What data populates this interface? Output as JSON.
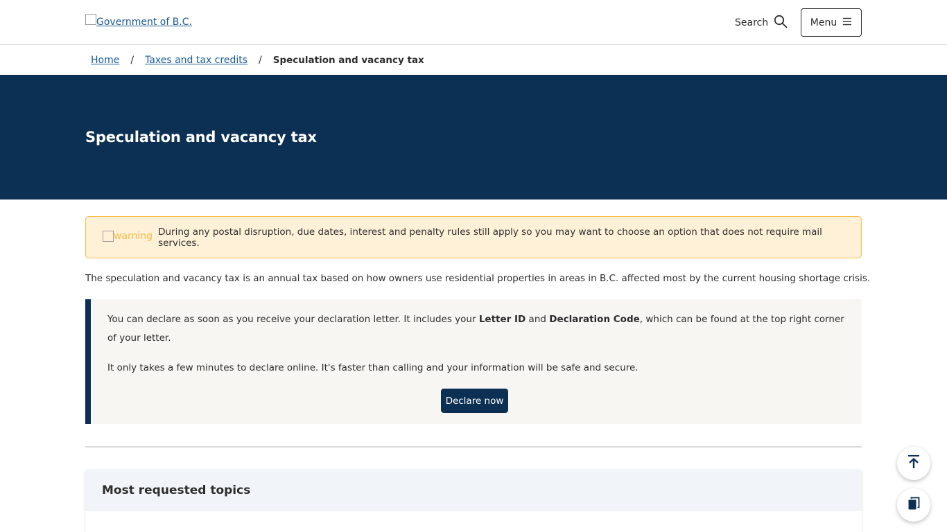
{
  "header": {
    "logo_alt": "Government of B.C.",
    "search_label": "Search",
    "menu_label": "Menu"
  },
  "breadcrumb": {
    "home": "Home",
    "separator": "/",
    "parent": "Taxes and tax credits",
    "current": "Speculation and vacancy tax"
  },
  "hero": {
    "title": "Speculation and vacancy tax"
  },
  "warning": {
    "icon_alt": "warning",
    "text": "During any postal disruption, due dates, interest and penalty rules still apply so you may want to choose an option that does not require mail services."
  },
  "intro": "The speculation and vacancy tax is an annual tax based on how owners use residential properties in areas in B.C. affected most by the current housing shortage crisis.",
  "callout": {
    "p1_before": "You can declare as soon as you receive your declaration letter. It includes your ",
    "p1_bold1": "Letter ID",
    "p1_mid": " and ",
    "p1_bold2": "Declaration Code",
    "p1_after": ", which can be found at the top right corner of your letter.",
    "p2": "It only takes a few minutes to declare online. It's faster than calling and your information will be safe and secure.",
    "button_label": "Declare now"
  },
  "topics": {
    "heading": "Most requested topics"
  },
  "colors": {
    "navy": "#0c3054",
    "link": "#1a5a96",
    "warning_bg": "#fef1d8",
    "warning_border": "#f8bb47"
  },
  "icons": {
    "search": "search-icon",
    "menu": "hamburger-icon",
    "back_to_top": "arrow-up-icon",
    "copy": "copy-icon"
  }
}
